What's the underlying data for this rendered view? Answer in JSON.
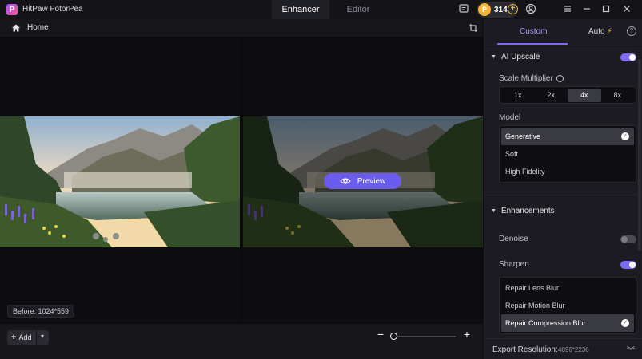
{
  "app": {
    "title": "HitPaw FotorPea",
    "logo_letter": "P"
  },
  "mode_tabs": [
    {
      "label": "Enhancer",
      "active": true
    },
    {
      "label": "Editor",
      "active": false
    }
  ],
  "credits": {
    "count": "314",
    "coin_symbol": "P"
  },
  "title_icons": [
    "message-icon",
    "coin-icon",
    "add-credits-icon",
    "account-icon",
    "menu-icon",
    "minimize-icon",
    "maximize-icon",
    "close-icon"
  ],
  "topbar": {
    "home_label": "Home"
  },
  "canvas": {
    "before_badge": "Before: 1024*559",
    "preview_label": "Preview"
  },
  "bottombar": {
    "add_label": "Add",
    "add_plus": "+",
    "zoom_minus": "−",
    "zoom_plus": "+",
    "zoom_level": 0.0
  },
  "panel": {
    "tabs": {
      "custom": "Custom",
      "auto": "Auto",
      "bolt": "⚡",
      "help": "?"
    },
    "ai_upscale": {
      "title": "AI Upscale",
      "enabled": true,
      "scale_label": "Scale Multiplier",
      "scale_options": [
        "1x",
        "2x",
        "4x",
        "8x"
      ],
      "scale_selected": "4x",
      "model_label": "Model",
      "models": [
        "Generative",
        "Soft",
        "High Fidelity"
      ],
      "model_selected": "Generative"
    },
    "enhancements": {
      "title": "Enhancements",
      "denoise_label": "Denoise",
      "denoise_enabled": false,
      "sharpen_label": "Sharpen",
      "sharpen_enabled": true,
      "sharpen_options": [
        "Repair Lens Blur",
        "Repair Motion Blur",
        "Repair Compression Blur"
      ],
      "sharpen_selected": "Repair Compression Blur"
    },
    "export": {
      "label": "Export Resolution:",
      "value": "4096*2236"
    }
  },
  "colors": {
    "accent": "#7c6cf4",
    "coin": "#f4b43a",
    "panel_bg": "#1b1b21"
  }
}
